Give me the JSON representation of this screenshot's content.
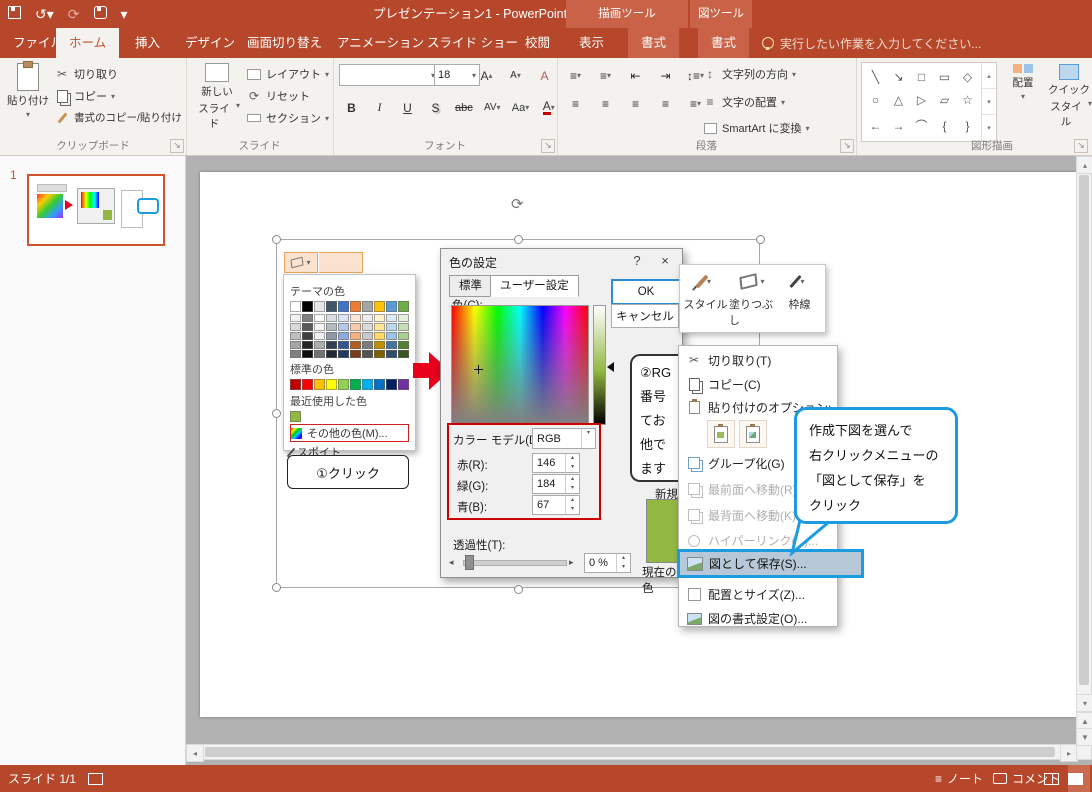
{
  "titlebar": {
    "title": "プレゼンテーション1 - PowerPoint",
    "contextual_headers": [
      "描画ツール",
      "図ツール"
    ]
  },
  "tabs": {
    "file": "ファイル",
    "main": [
      "ホーム",
      "挿入",
      "デザイン",
      "画面切り替え",
      "アニメーション",
      "スライド ショー",
      "校閲",
      "表示"
    ],
    "contextual": [
      "書式",
      "書式"
    ],
    "tell_me": "実行したい作業を入力してください..."
  },
  "ribbon": {
    "clipboard": {
      "label": "クリップボード",
      "paste": "貼り付け",
      "cut": "切り取り",
      "copy": "コピー",
      "format_painter": "書式のコピー/貼り付け"
    },
    "slides": {
      "label": "スライド",
      "new_slide_1": "新しい",
      "new_slide_2": "スライド",
      "layout": "レイアウト",
      "reset": "リセット",
      "section": "セクション"
    },
    "font": {
      "label": "フォント",
      "size": "18",
      "bold": "B",
      "italic": "I",
      "underline": "U",
      "shadow": "S",
      "strike": "abc",
      "spacing": "AV",
      "case": "Aa",
      "color": "A"
    },
    "paragraph": {
      "label": "段落",
      "direction": "文字列の方向",
      "align_text": "文字の配置",
      "smartart": "SmartArt に変換"
    },
    "drawing": {
      "label": "図形描画",
      "arrange": "配置",
      "quick1": "クイック",
      "quick2": "スタイル"
    },
    "shape_glyphs": [
      "╲",
      "↘",
      "□",
      "▭",
      "◇",
      "○",
      "△",
      "▷",
      "▱",
      "☆",
      "←",
      "→",
      "⌒",
      "{",
      "}"
    ]
  },
  "thumbnails": {
    "slide_number": "1"
  },
  "slide": {
    "color_dropdown": {
      "theme_label": "テーマの色",
      "standard_label": "標準の色",
      "recent_label": "最近使用した色",
      "more_colors": "その他の色(M)...",
      "eyedropper": "スポイト",
      "theme_colors": [
        "#FFFFFF",
        "#000000",
        "#E7E6E6",
        "#44546A",
        "#4472C4",
        "#ED7D31",
        "#A5A5A5",
        "#FFC000",
        "#5B9BD5",
        "#70AD47"
      ],
      "standard_colors": [
        "#C00000",
        "#FF0000",
        "#FFC000",
        "#FFFF00",
        "#92D050",
        "#00B050",
        "#00B0F0",
        "#0070C0",
        "#002060",
        "#7030A0"
      ],
      "recent_colors": [
        "#92B843"
      ]
    },
    "click_callout": "①クリック",
    "color_dialog": {
      "title": "色の設定",
      "help": "?",
      "close": "×",
      "tab_standard": "標準",
      "tab_custom": "ユーザー設定",
      "color_label": "色(C):",
      "ok": "OK",
      "cancel": "キャンセル",
      "model_label": "カラー モデル(D):",
      "model_value": "RGB",
      "red_label": "赤(R):",
      "red_value": "146",
      "green_label": "緑(G):",
      "green_value": "184",
      "blue_label": "青(B):",
      "blue_value": "67",
      "transparency_label": "透過性(T):",
      "transparency_value": "0 %",
      "new_label": "新規",
      "current_label": "現在の色",
      "selected_color": "#92B843"
    },
    "partial_bubble_lines": [
      "②RG",
      "番号",
      "てお",
      "他で",
      "ます"
    ],
    "mini_toolbar": {
      "style": "スタイル",
      "fill": "塗りつぶし",
      "outline": "枠線"
    },
    "context_menu": {
      "cut": "切り取り(T)",
      "copy": "コピー(C)",
      "paste_options": "貼り付けのオプション:",
      "group": "グループ化(G)",
      "bring_front": "最前面へ移動(R)",
      "send_back": "最背面へ移動(K)",
      "hyperlink": "ハイパーリンク(H)...",
      "save_as_picture": "図として保存(S)...",
      "size_position": "配置とサイズ(Z)...",
      "format_picture": "図の書式設定(O)..."
    },
    "blue_callout_lines": [
      "作成下図を選んで",
      "右クリックメニューの",
      "「図として保存」を",
      "クリック"
    ]
  },
  "statusbar": {
    "slide_counter": "スライド 1/1",
    "notes": "ノート",
    "comments": "コメント"
  },
  "icons": {
    "dropdown": "▾",
    "tri_up": "▴",
    "tri_down": "▾",
    "tri_left": "◂",
    "tri_right": "▸",
    "undo": "↺",
    "redo": "⟳",
    "rotate": "⟳",
    "scissors": "✂",
    "launcher": "↘",
    "list": "≡",
    "updown": "↕",
    "indent_left": "⇤",
    "indent_right": "⇥",
    "left_right": "↔",
    "prev": "▲",
    "next": "▼"
  },
  "colors": {
    "accent": "#B7472A",
    "contextual_tab": "#C96247",
    "highlight_blue": "#1D9BE1",
    "annotation_red": "#CC2222",
    "selected_green": "#92B843"
  }
}
